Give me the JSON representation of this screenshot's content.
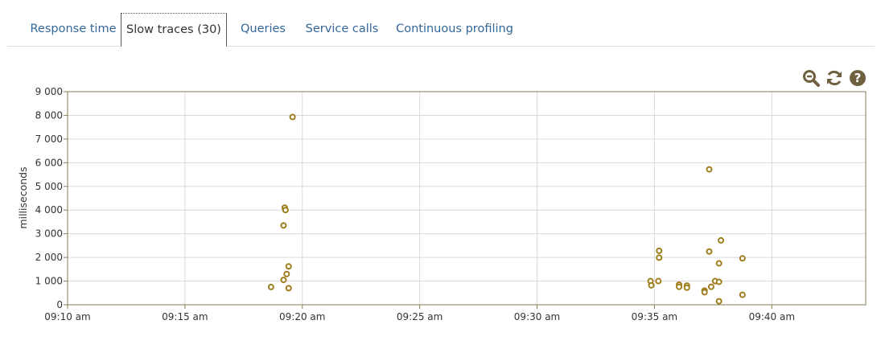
{
  "tabs": [
    {
      "label": "Response time",
      "active": false
    },
    {
      "label": "Slow traces (30)",
      "active": true
    },
    {
      "label": "Queries",
      "active": false
    },
    {
      "label": "Service calls",
      "active": false
    },
    {
      "label": "Continuous profiling",
      "active": false
    }
  ],
  "toolbar": {
    "icons": [
      "zoom-out-icon",
      "refresh-icon",
      "help-icon"
    ],
    "icon_color": "#7a6a4a"
  },
  "colors": {
    "point_stroke": "#a07d1c",
    "plot_border": "#8a7a55",
    "grid": "#d9d9d9",
    "tab_link": "#336699"
  },
  "chart_data": {
    "type": "scatter",
    "ylabel": "milliseconds",
    "x_ticks": [
      "09:10 am",
      "09:15 am",
      "09:20 am",
      "09:25 am",
      "09:30 am",
      "09:35 am",
      "09:40 am"
    ],
    "y_ticks": [
      "0",
      "1 000",
      "2 000",
      "3 000",
      "4 000",
      "5 000",
      "6 000",
      "7 000",
      "8 000",
      "9 000"
    ],
    "xlim": [
      "09:10",
      "09:44"
    ],
    "ylim": [
      0,
      9000
    ],
    "grid": true,
    "points": [
      {
        "x": "09:18:40",
        "y": 750
      },
      {
        "x": "09:19:12",
        "y": 1050
      },
      {
        "x": "09:19:15",
        "y": 4100
      },
      {
        "x": "09:19:17",
        "y": 4000
      },
      {
        "x": "09:19:12",
        "y": 3350
      },
      {
        "x": "09:19:20",
        "y": 1300
      },
      {
        "x": "09:19:25",
        "y": 1620
      },
      {
        "x": "09:19:25",
        "y": 700
      },
      {
        "x": "09:19:35",
        "y": 7930
      },
      {
        "x": "09:34:50",
        "y": 1000
      },
      {
        "x": "09:34:52",
        "y": 820
      },
      {
        "x": "09:35:12",
        "y": 2280
      },
      {
        "x": "09:35:12",
        "y": 1990
      },
      {
        "x": "09:35:10",
        "y": 1000
      },
      {
        "x": "09:36:03",
        "y": 850
      },
      {
        "x": "09:36:03",
        "y": 760
      },
      {
        "x": "09:36:23",
        "y": 810
      },
      {
        "x": "09:36:23",
        "y": 720
      },
      {
        "x": "09:37:08",
        "y": 600
      },
      {
        "x": "09:37:08",
        "y": 530
      },
      {
        "x": "09:37:20",
        "y": 5720
      },
      {
        "x": "09:37:20",
        "y": 2250
      },
      {
        "x": "09:37:25",
        "y": 760
      },
      {
        "x": "09:37:35",
        "y": 1000
      },
      {
        "x": "09:37:45",
        "y": 1750
      },
      {
        "x": "09:37:45",
        "y": 970
      },
      {
        "x": "09:37:45",
        "y": 150
      },
      {
        "x": "09:37:50",
        "y": 2720
      },
      {
        "x": "09:38:45",
        "y": 1960
      },
      {
        "x": "09:38:45",
        "y": 420
      }
    ]
  }
}
